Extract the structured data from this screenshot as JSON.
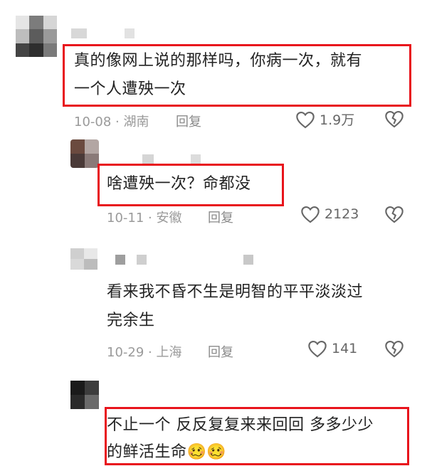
{
  "comments": [
    {
      "text_lines": [
        "真的像网上说的那样吗，你病一次，就有",
        "一个人遭殃一次"
      ],
      "date": "10-08",
      "location": "湖南",
      "reply_label": "回复",
      "likes": "1.9万"
    },
    {
      "text_lines": [
        "啥遭殃一次？命都没"
      ],
      "date": "10-11",
      "location": "安徽",
      "reply_label": "回复",
      "likes": "2123"
    },
    {
      "text_lines": [
        "看来我不昏不生是明智的平平淡淡过",
        "完余生"
      ],
      "date": "10-29",
      "location": "上海",
      "reply_label": "回复",
      "likes": "141"
    },
    {
      "text_lines": [
        "不止一个 反反复复来来回回  多多少少",
        "的鲜活生命"
      ],
      "emoji": "🥴🥴"
    }
  ],
  "colors": {
    "highlight_box": "#e8141c",
    "meta_text": "#9a9a9a"
  },
  "icons": [
    "heart-icon",
    "broken-heart-icon"
  ]
}
